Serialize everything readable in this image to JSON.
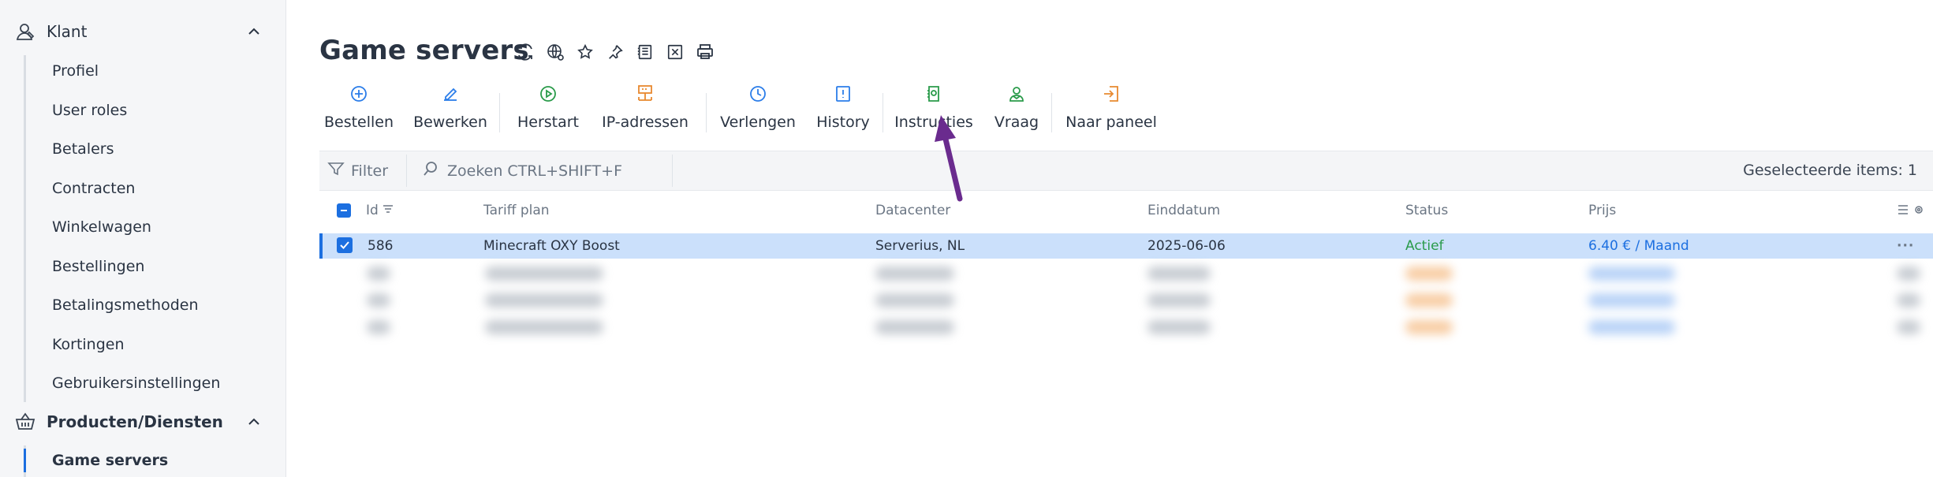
{
  "sidebar": {
    "section_client": {
      "label": "Klant",
      "icon": "user-icon"
    },
    "client_items": [
      "Profiel",
      "User roles",
      "Betalers",
      "Contracten",
      "Winkelwagen",
      "Bestellingen",
      "Betalingsmethoden",
      "Kortingen",
      "Gebruikersinstellingen"
    ],
    "section_products": {
      "label": "Producten/Diensten",
      "icon": "basket-icon"
    },
    "product_items": [
      "Game servers"
    ]
  },
  "page": {
    "title": "Game servers"
  },
  "toolbar": {
    "order": "Bestellen",
    "edit": "Bewerken",
    "restart": "Herstart",
    "ip": "IP-adressen",
    "renew": "Verlengen",
    "history": "History",
    "instructions": "Instructies",
    "question": "Vraag",
    "panel": "Naar paneel"
  },
  "filterbar": {
    "filter": "Filter",
    "search_placeholder": "Zoeken CTRL+SHIFT+F",
    "selected": "Geselecteerde items: 1"
  },
  "table": {
    "columns": [
      "Id",
      "Tariff plan",
      "Datacenter",
      "Einddatum",
      "Status",
      "Prijs"
    ],
    "rows": [
      {
        "id": "586",
        "plan": "Minecraft OXY Boost",
        "datacenter": "Serverius, NL",
        "end": "2025-06-06",
        "status": "Actief",
        "price": "6.40 € / Maand"
      }
    ]
  },
  "colors": {
    "accent": "#1c6fe0",
    "active_status": "#2a9b4a",
    "annotation_arrow": "#6a2b8e"
  }
}
